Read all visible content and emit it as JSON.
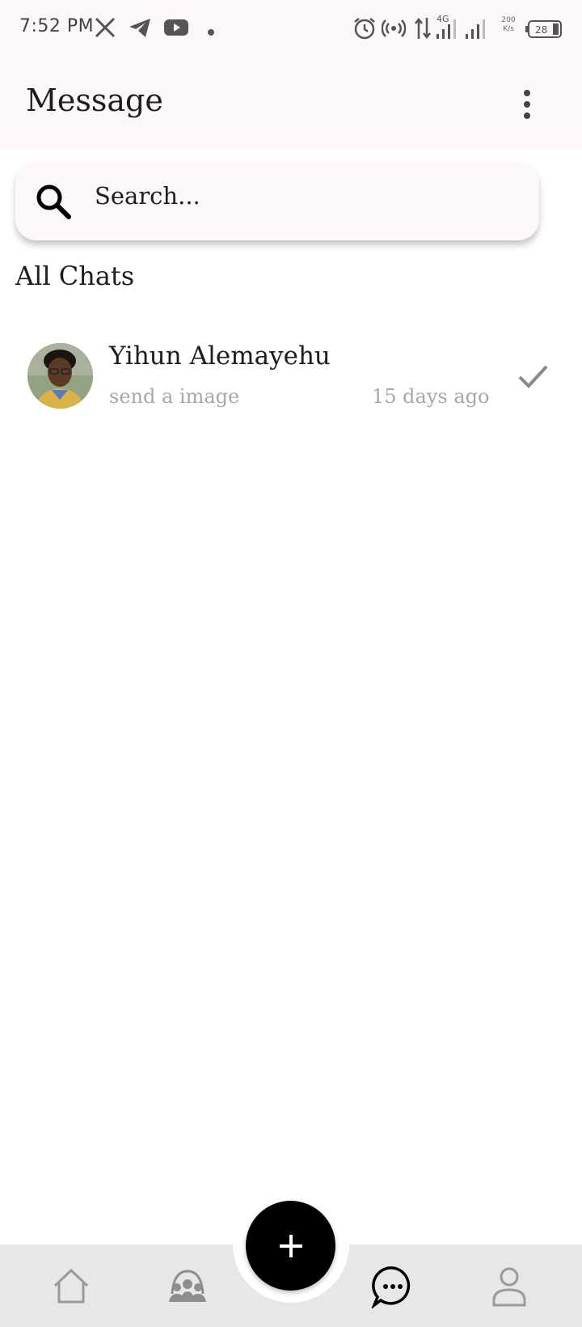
{
  "status_bar": {
    "time": "7:52 PM",
    "network": "4G",
    "speed": "200 K/s",
    "battery": "28",
    "icons": [
      "x-icon",
      "telegram-icon",
      "youtube-icon",
      "dot-icon",
      "alarm-icon",
      "hotspot-icon",
      "data-arrows-icon",
      "signal-icon",
      "signal-icon-2",
      "battery-icon"
    ]
  },
  "header": {
    "title": "Message",
    "menu_icon": "more-vert-icon"
  },
  "search": {
    "placeholder": "Search...",
    "value": ""
  },
  "section": {
    "title": "All Chats"
  },
  "chats": [
    {
      "name": "Yihun Alemayehu",
      "last_message": "send a image",
      "time": "15 days ago",
      "status_icon": "check-icon"
    }
  ],
  "fab": {
    "icon": "plus-icon"
  },
  "bottom_nav": {
    "items": [
      {
        "icon": "home-icon",
        "active": false
      },
      {
        "icon": "group-icon",
        "active": false
      },
      {
        "icon": "chat-bubble-icon",
        "active": true
      },
      {
        "icon": "person-icon",
        "active": false
      }
    ]
  },
  "colors": {
    "background": "#ffffff",
    "app_bar": "#fdf7fb",
    "nav_bar": "#e8e6e8",
    "fab": "#000000",
    "secondary_text": "#a9a6a8",
    "inactive_icon": "#9a9a9a"
  }
}
